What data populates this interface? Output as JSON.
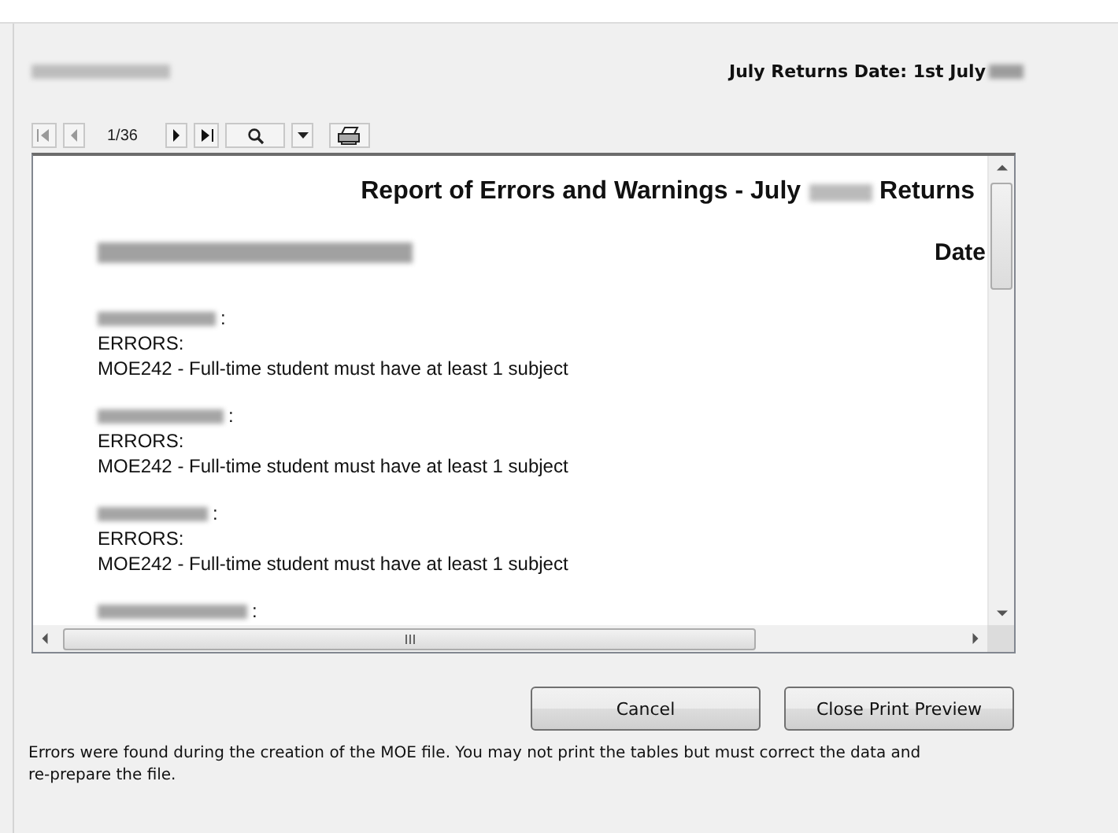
{
  "header": {
    "returns_date": "July Returns Date: 1st July"
  },
  "toolbar": {
    "page_indicator": "1/36"
  },
  "report": {
    "title_start": "Report of Errors and Warnings - July",
    "title_end": "Returns",
    "date_label": "Date",
    "entries": [
      {
        "separator": ":",
        "section": "ERRORS:",
        "message": "MOE242 - Full-time student must have at least 1 subject"
      },
      {
        "separator": ":",
        "section": "ERRORS:",
        "message": "MOE242 - Full-time student must have at least 1 subject"
      },
      {
        "separator": ":",
        "section": "ERRORS:",
        "message": "MOE242 - Full-time student must have at least 1 subject"
      },
      {
        "separator": ":"
      }
    ]
  },
  "buttons": [
    {
      "label": "Cancel"
    },
    {
      "label": "Close Print Preview"
    }
  ],
  "message": "Errors were found during the creation of the MOE file.  You may not print the tables but must correct the data and re-prepare the file."
}
